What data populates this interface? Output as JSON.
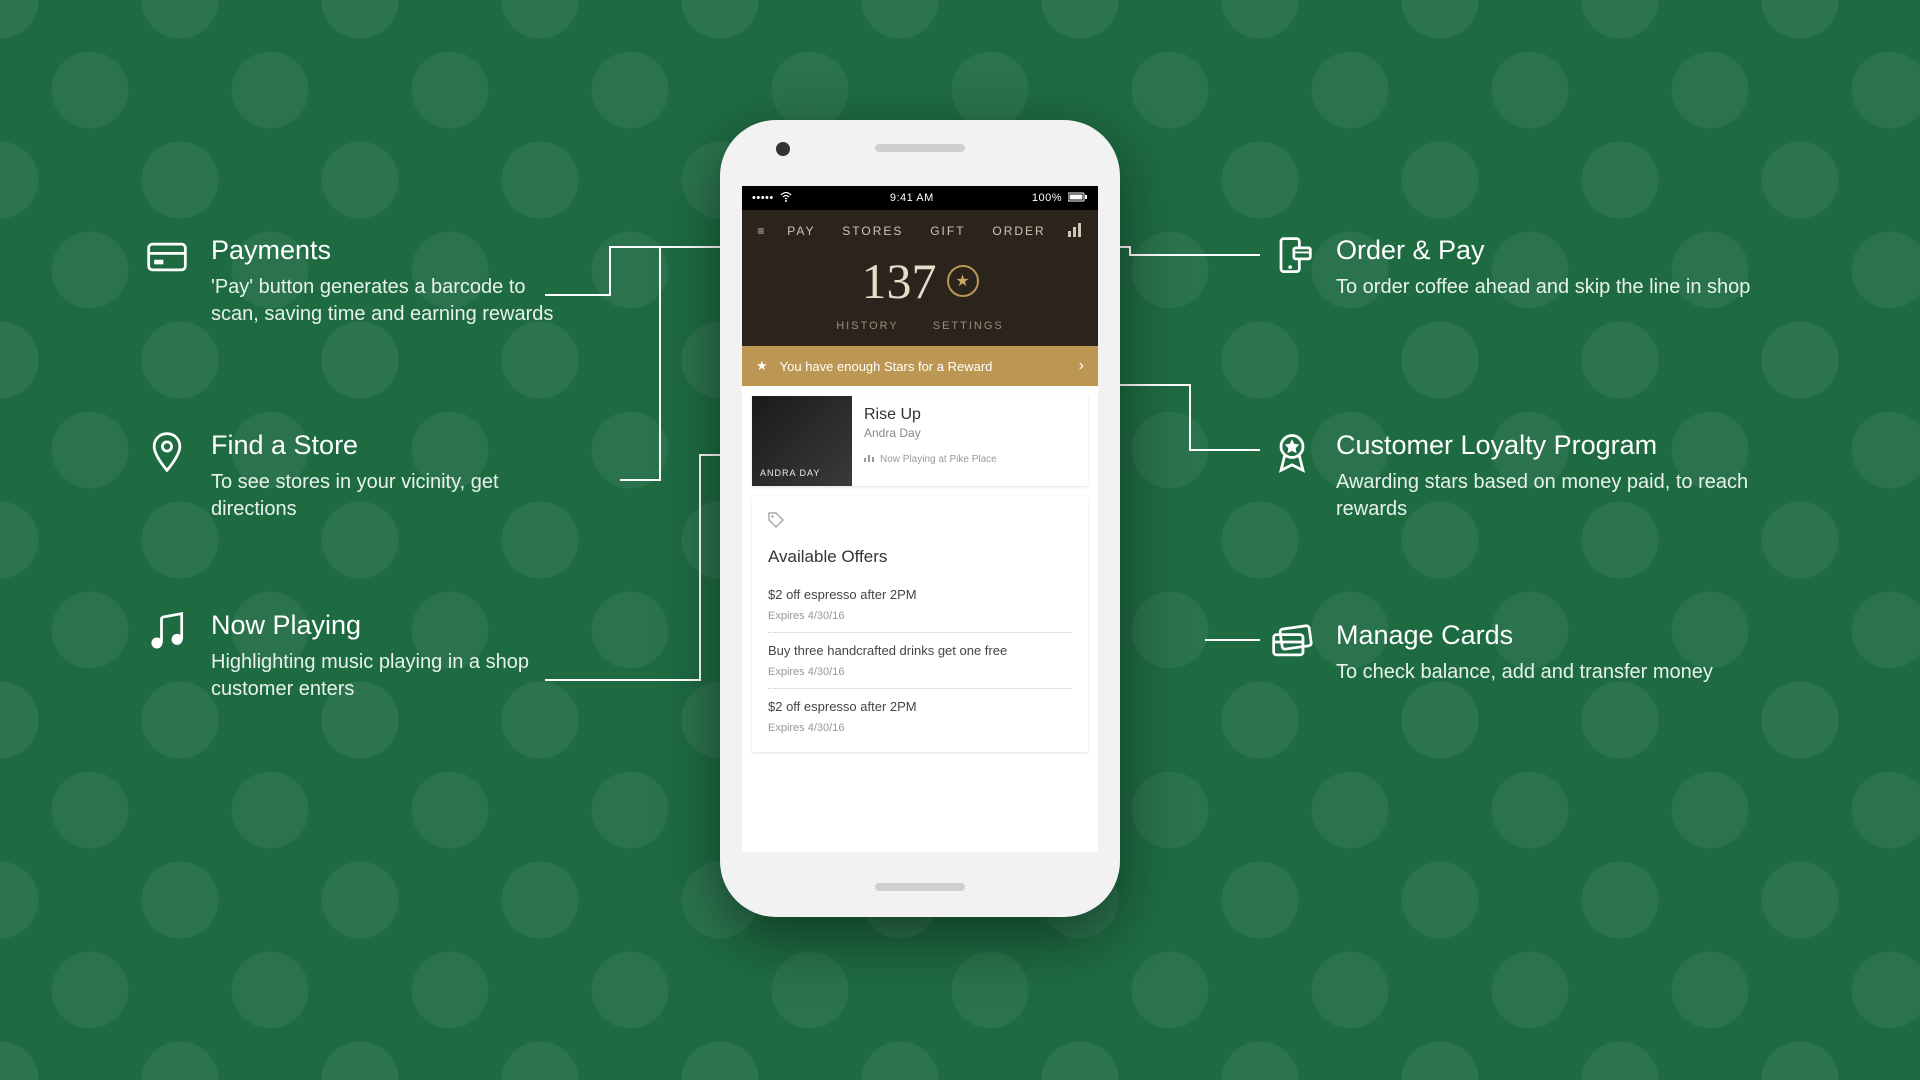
{
  "left": {
    "payments": {
      "title": "Payments",
      "desc": "'Pay' button generates a barcode to scan, saving time and earning rewards"
    },
    "store": {
      "title": "Find a Store",
      "desc": "To see stores in your vicinity, get directions"
    },
    "now": {
      "title": "Now Playing",
      "desc": "Highlighting music playing in a shop customer enters"
    }
  },
  "right": {
    "order": {
      "title": "Order & Pay",
      "desc": "To order coffee ahead and skip the line in shop"
    },
    "loyalty": {
      "title": "Customer Loyalty Program",
      "desc": "Awarding stars based on money paid, to reach rewards"
    },
    "cards": {
      "title": "Manage Cards",
      "desc": "To check balance, add and transfer money"
    }
  },
  "phone": {
    "status": {
      "time": "9:41 AM",
      "battery": "100%"
    },
    "tabs": {
      "pay": "PAY",
      "stores": "STORES",
      "gift": "GIFT",
      "order": "ORDER"
    },
    "stars": "137",
    "subtabs": {
      "history": "HISTORY",
      "settings": "SETTINGS"
    },
    "reward_banner": "You have enough Stars for a Reward",
    "now_playing": {
      "art_label": "ANDRA DAY",
      "title": "Rise Up",
      "artist": "Andra Day",
      "location": "Now Playing at Pike Place"
    },
    "offers_header": "Available Offers",
    "offers": [
      {
        "title": "$2 off espresso after 2PM",
        "expires": "Expires 4/30/16"
      },
      {
        "title": "Buy three handcrafted drinks get one free",
        "expires": "Expires 4/30/16"
      },
      {
        "title": "$2 off espresso after 2PM",
        "expires": "Expires 4/30/16"
      }
    ]
  }
}
